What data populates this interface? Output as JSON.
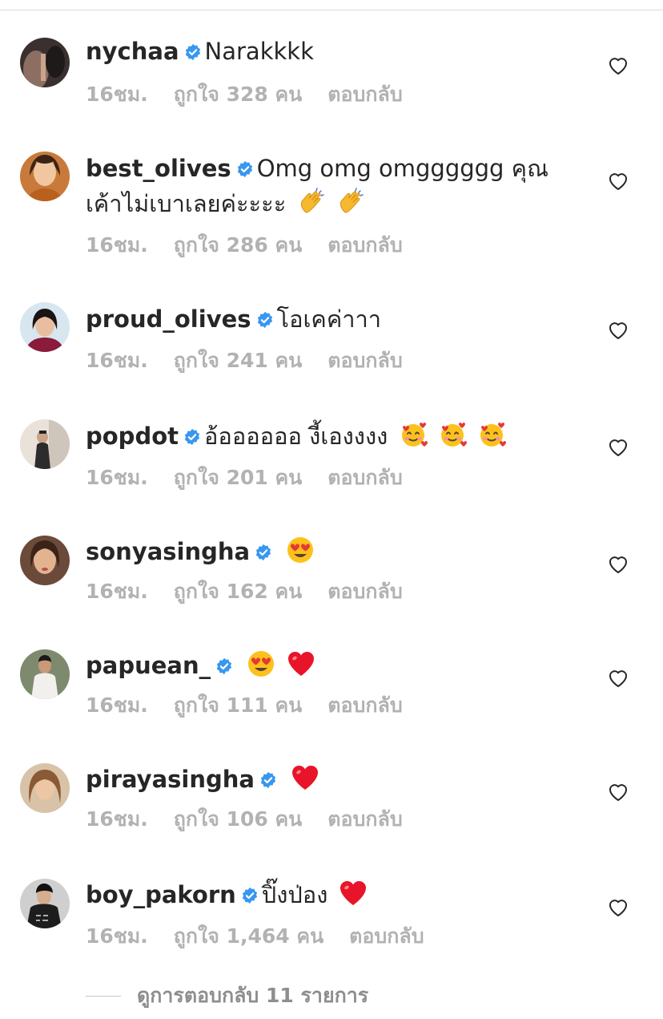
{
  "colors": {
    "text": "#262626",
    "meta": "#b2b2b2",
    "verified": "#3897f0",
    "divider": "#dbdbdb"
  },
  "comments": [
    {
      "username": "nychaa",
      "verified": true,
      "text": "Narakkkk",
      "emojis": [],
      "time": "16ชม.",
      "likes": "ถูกใจ 328 คน",
      "reply": "ตอบกลับ"
    },
    {
      "username": "best_olives",
      "verified": true,
      "text": "Omg omg omgggggg คุณเค้าไม่เบาเลยค่ะะะะ",
      "emojis": [
        "clapping-hands-emoji",
        "clapping-hands-emoji"
      ],
      "time": "16ชม.",
      "likes": "ถูกใจ 286 คน",
      "reply": "ตอบกลับ"
    },
    {
      "username": "proud_olives",
      "verified": true,
      "text": "โอเคค่าาา",
      "emojis": [],
      "time": "16ชม.",
      "likes": "ถูกใจ 241 คน",
      "reply": "ตอบกลับ"
    },
    {
      "username": "popdot",
      "verified": true,
      "text": "อ้ออออออ งี้เองงงง",
      "emojis": [
        "smiling-face-with-hearts-emoji",
        "smiling-face-with-hearts-emoji",
        "smiling-face-with-hearts-emoji"
      ],
      "time": "16ชม.",
      "likes": "ถูกใจ 201 คน",
      "reply": "ตอบกลับ"
    },
    {
      "username": "sonyasingha",
      "verified": true,
      "text": "",
      "emojis": [
        "heart-eyes-emoji"
      ],
      "time": "16ชม.",
      "likes": "ถูกใจ 162 คน",
      "reply": "ตอบกลับ"
    },
    {
      "username": "papuean_",
      "verified": true,
      "text": "",
      "emojis": [
        "heart-eyes-emoji",
        "red-heart-emoji"
      ],
      "time": "16ชม.",
      "likes": "ถูกใจ 111 คน",
      "reply": "ตอบกลับ"
    },
    {
      "username": "pirayasingha",
      "verified": true,
      "text": "",
      "emojis": [
        "red-heart-emoji"
      ],
      "time": "16ชม.",
      "likes": "ถูกใจ 106 คน",
      "reply": "ตอบกลับ"
    },
    {
      "username": "boy_pakorn",
      "verified": true,
      "text": "ปิ๊งป่อง",
      "emojis": [
        "red-heart-emoji"
      ],
      "time": "16ชม.",
      "likes": "ถูกใจ 1,464 คน",
      "reply": "ตอบกลับ"
    }
  ],
  "view_replies": "ดูการตอบกลับ 11 รายการ"
}
